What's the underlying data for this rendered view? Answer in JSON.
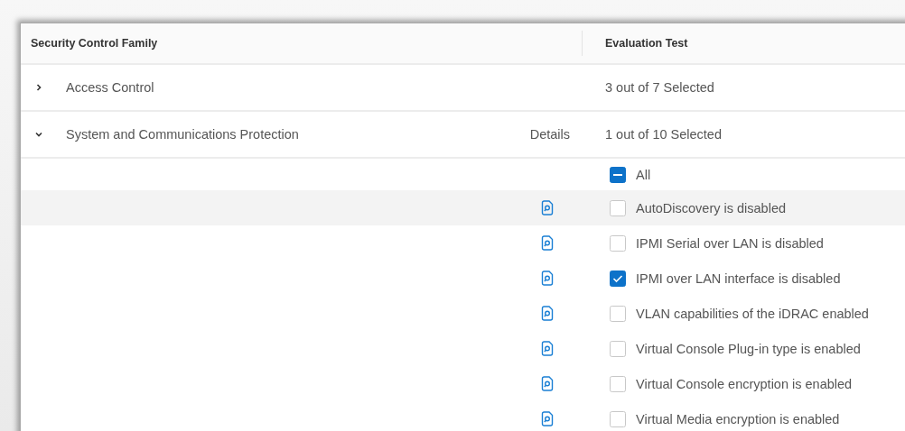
{
  "table": {
    "columns": [
      "Security Control Family",
      "Evaluation Test"
    ],
    "families": [
      {
        "name": "Access Control",
        "expanded": false,
        "summary": "3 out of 7 Selected"
      },
      {
        "name": "System and Communications Protection",
        "expanded": true,
        "details": "Details",
        "summary": "1 out of 10 Selected",
        "select_all": {
          "label": "All",
          "indeterminate": true
        },
        "tests": [
          {
            "label": "AutoDiscovery is disabled",
            "checked": false,
            "hovered": true
          },
          {
            "label": "IPMI Serial over LAN is disabled",
            "checked": false,
            "hovered": false
          },
          {
            "label": "IPMI over LAN interface is disabled",
            "checked": true,
            "hovered": false
          },
          {
            "label": "VLAN capabilities of the iDRAC enabled",
            "checked": false,
            "hovered": false
          },
          {
            "label": "Virtual Console Plug-in type is enabled",
            "checked": false,
            "hovered": false
          },
          {
            "label": "Virtual Console encryption is enabled",
            "checked": false,
            "hovered": false
          },
          {
            "label": "Virtual Media encryption is enabled",
            "checked": false,
            "hovered": false
          }
        ]
      }
    ]
  }
}
